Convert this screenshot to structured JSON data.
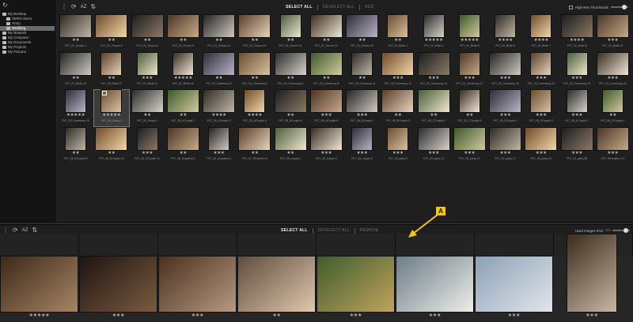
{
  "tree": {
    "items": [
      {
        "label": "My Desktop",
        "level": 0
      },
      {
        "label": "SMRH demo",
        "level": 1
      },
      {
        "label": "Temp",
        "level": 1
      },
      {
        "label": "Wedding",
        "level": 1,
        "selected": true
      },
      {
        "label": "My Network",
        "level": 0
      },
      {
        "label": "My Computer",
        "level": 0
      },
      {
        "label": "My Documents",
        "level": 0
      },
      {
        "label": "My Projects",
        "level": 0
      },
      {
        "label": "My Pictures",
        "level": 0
      }
    ]
  },
  "top_toolbar": {
    "sort_label": "AZ",
    "select_all": "SELECT ALL",
    "deselect_all": "DESELECT ALL",
    "add": "ADD",
    "high_res": "High-Res Thumbnails"
  },
  "bottom_toolbar": {
    "sort_label": "AZ",
    "select_all": "SELECT ALL",
    "deselect_all": "DESELECT ALL",
    "remove": "REMOVE",
    "used_images": "Used Images 0/10"
  },
  "callout": "A",
  "thumbnails": [
    {
      "cap": "FK7_01_Groom-1",
      "stars": "★★"
    },
    {
      "cap": "FK7_01_Groom-3",
      "stars": "★★"
    },
    {
      "cap": "FK7_01_Groom-6",
      "stars": "★★"
    },
    {
      "cap": "FK7_01_Groom-9",
      "stars": "★★"
    },
    {
      "cap": "FK7_01_Groom-11",
      "stars": "★★"
    },
    {
      "cap": "FK7_01_Groom-14",
      "stars": "★★"
    },
    {
      "cap": "FK7_01_Groom-21",
      "stars": "★★"
    },
    {
      "cap": "FK7_01_Groom-22",
      "stars": "★★"
    },
    {
      "cap": "FK7_01_Groom-24",
      "stars": "★★"
    },
    {
      "cap": "FK7_02_Bride-1",
      "stars": "★★"
    },
    {
      "cap": "FK7_02_Bride-3",
      "stars": "★★★★★"
    },
    {
      "cap": "FK7_02_Bride-5",
      "stars": "★★★★★"
    },
    {
      "cap": "FK7_02_Bride-6",
      "stars": "★★★★"
    },
    {
      "cap": "FK7_02_Bride-7",
      "stars": "★★★★"
    },
    {
      "cap": "FK7_02_Bride-8",
      "stars": "★★★★"
    },
    {
      "cap": "FK7_02_Bride-11",
      "stars": "★★★"
    },
    {
      "cap": "FK7_02_Bride-10",
      "stars": "★★"
    },
    {
      "cap": "FK7_02_Bride-12",
      "stars": "★★"
    },
    {
      "cap": "FK7_02_Bride-14",
      "stars": "★★★"
    },
    {
      "cap": "FK7_02_Bride-15",
      "stars": "★★★★★"
    },
    {
      "cap": "FK7_03_Ceremony-3",
      "stars": "★★"
    },
    {
      "cap": "FK7_03_Ceremony-5",
      "stars": "★★"
    },
    {
      "cap": "FK7_03_Ceremony-6",
      "stars": "★★"
    },
    {
      "cap": "FK7_03_Ceremony-8",
      "stars": "★★"
    },
    {
      "cap": "FK7_03_Ceremony-11",
      "stars": "★★"
    },
    {
      "cap": "FK7_03_Ceremony-12",
      "stars": "★★★"
    },
    {
      "cap": "FK7_03_Ceremony-13",
      "stars": "★★★"
    },
    {
      "cap": "FK7_03_Ceremony-17",
      "stars": "★★★"
    },
    {
      "cap": "FK7_03_Ceremony-18",
      "stars": "★★★"
    },
    {
      "cap": "FK7_03_Ceremony-20",
      "stars": "★★★"
    },
    {
      "cap": "FK7_03_Ceremony-22",
      "stars": "★★★"
    },
    {
      "cap": "FK7_03_Ceremony-24",
      "stars": "★★★"
    },
    {
      "cap": "FK7_03_Ceremony-25",
      "stars": "★★★★★"
    },
    {
      "cap": "FK7_04_Group-1",
      "stars": "★★★★★",
      "selected": true
    },
    {
      "cap": "FK7_04_Group-2",
      "stars": "★★"
    },
    {
      "cap": "FK7_05_ACouple-2",
      "stars": "★★"
    },
    {
      "cap": "FK7_05_ACouple-3",
      "stars": "★★★★"
    },
    {
      "cap": "FK7_05_ACouple-4",
      "stars": "★★★★"
    },
    {
      "cap": "FK7_05_ACouple-6",
      "stars": "★★"
    },
    {
      "cap": "FK7_05_ACouple-8",
      "stars": "★★★"
    },
    {
      "cap": "FK7_05_BCouple-1",
      "stars": "★★★"
    },
    {
      "cap": "FK7_05_BCouple-3",
      "stars": "★★"
    },
    {
      "cap": "FK7_05_CCouple-2",
      "stars": "★★"
    },
    {
      "cap": "FK7_05_CCouple-5",
      "stars": "★★"
    },
    {
      "cap": "FK7_05_DCouple-1",
      "stars": "★★★"
    },
    {
      "cap": "FK7_05_DCouple-3",
      "stars": "★★★"
    },
    {
      "cap": "FK7_05_DCouple-7",
      "stars": "★★★"
    },
    {
      "cap": "FK7_05_DCouple-4",
      "stars": "★★"
    },
    {
      "cap": "FK7_05_DCouple-5",
      "stars": "★★"
    },
    {
      "cap": "FK7_05_DCouple-10",
      "stars": "★★"
    },
    {
      "cap": "FK7_05_DCouple-11",
      "stars": "★★★"
    },
    {
      "cap": "FK7_06_reception-1",
      "stars": "★★"
    },
    {
      "cap": "FK7_06_reception-4",
      "stars": "★★★"
    },
    {
      "cap": "FK7_07_Reception-6",
      "stars": "★★"
    },
    {
      "cap": "FK7_08_couple-1",
      "stars": "★★"
    },
    {
      "cap": "FK7_08_couple-3",
      "stars": "★★★"
    },
    {
      "cap": "FK7_08_couple-5",
      "stars": "★★★"
    },
    {
      "cap": "FK7_09_party-2",
      "stars": "★★★"
    },
    {
      "cap": "FK7_09_party-12",
      "stars": "★★★"
    },
    {
      "cap": "FK7_09_party-13",
      "stars": "★★★"
    },
    {
      "cap": "FK7_09_party-17",
      "stars": "★★★"
    },
    {
      "cap": "FK7_09_party-21",
      "stars": "★★★"
    },
    {
      "cap": "FK7_09_party-26",
      "stars": "★★★"
    },
    {
      "cap": "FK7_Reception-2-3",
      "stars": "★★★"
    }
  ],
  "filmstrip": [
    {
      "stars": "★★★★★"
    },
    {
      "stars": "★★★"
    },
    {
      "stars": "★★★"
    },
    {
      "stars": "★★"
    },
    {
      "stars": "★★★"
    },
    {
      "stars": "★★★"
    },
    {
      "stars": "★★★"
    },
    {
      "stars": "★★★"
    }
  ],
  "colors": {
    "callout": "#f3c60f",
    "bg": "#1f1f1f",
    "panel": "#141414"
  }
}
